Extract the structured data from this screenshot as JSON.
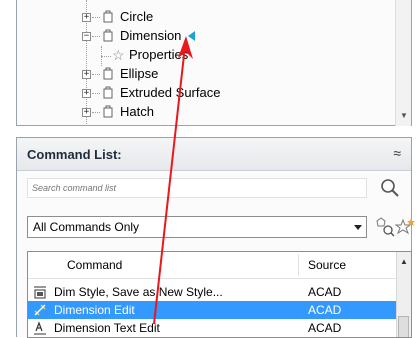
{
  "tree": {
    "items": [
      {
        "label": "Circle"
      },
      {
        "label": "Dimension"
      },
      {
        "label": "Properties"
      },
      {
        "label": "Ellipse"
      },
      {
        "label": "Extruded Surface"
      },
      {
        "label": "Hatch"
      }
    ]
  },
  "command_panel": {
    "title": "Command List:",
    "search_placeholder": "Search command list",
    "filter_value": "All Commands Only",
    "columns": {
      "command": "Command",
      "source": "Source"
    },
    "rows": [
      {
        "name": "Dim Style, Save as New Style...",
        "source": "ACAD"
      },
      {
        "name": "Dimension Edit",
        "source": "ACAD"
      },
      {
        "name": "Dimension Text Edit",
        "source": "ACAD"
      }
    ]
  },
  "colors": {
    "selection": "#3399ff",
    "arrow": "#e8181c",
    "marker": "#1aa3d9"
  },
  "icons": [
    "plus-icon",
    "minus-icon",
    "node-icon",
    "star-icon",
    "search-icon",
    "filter-icon",
    "new-command-icon",
    "collapse-icon"
  ]
}
